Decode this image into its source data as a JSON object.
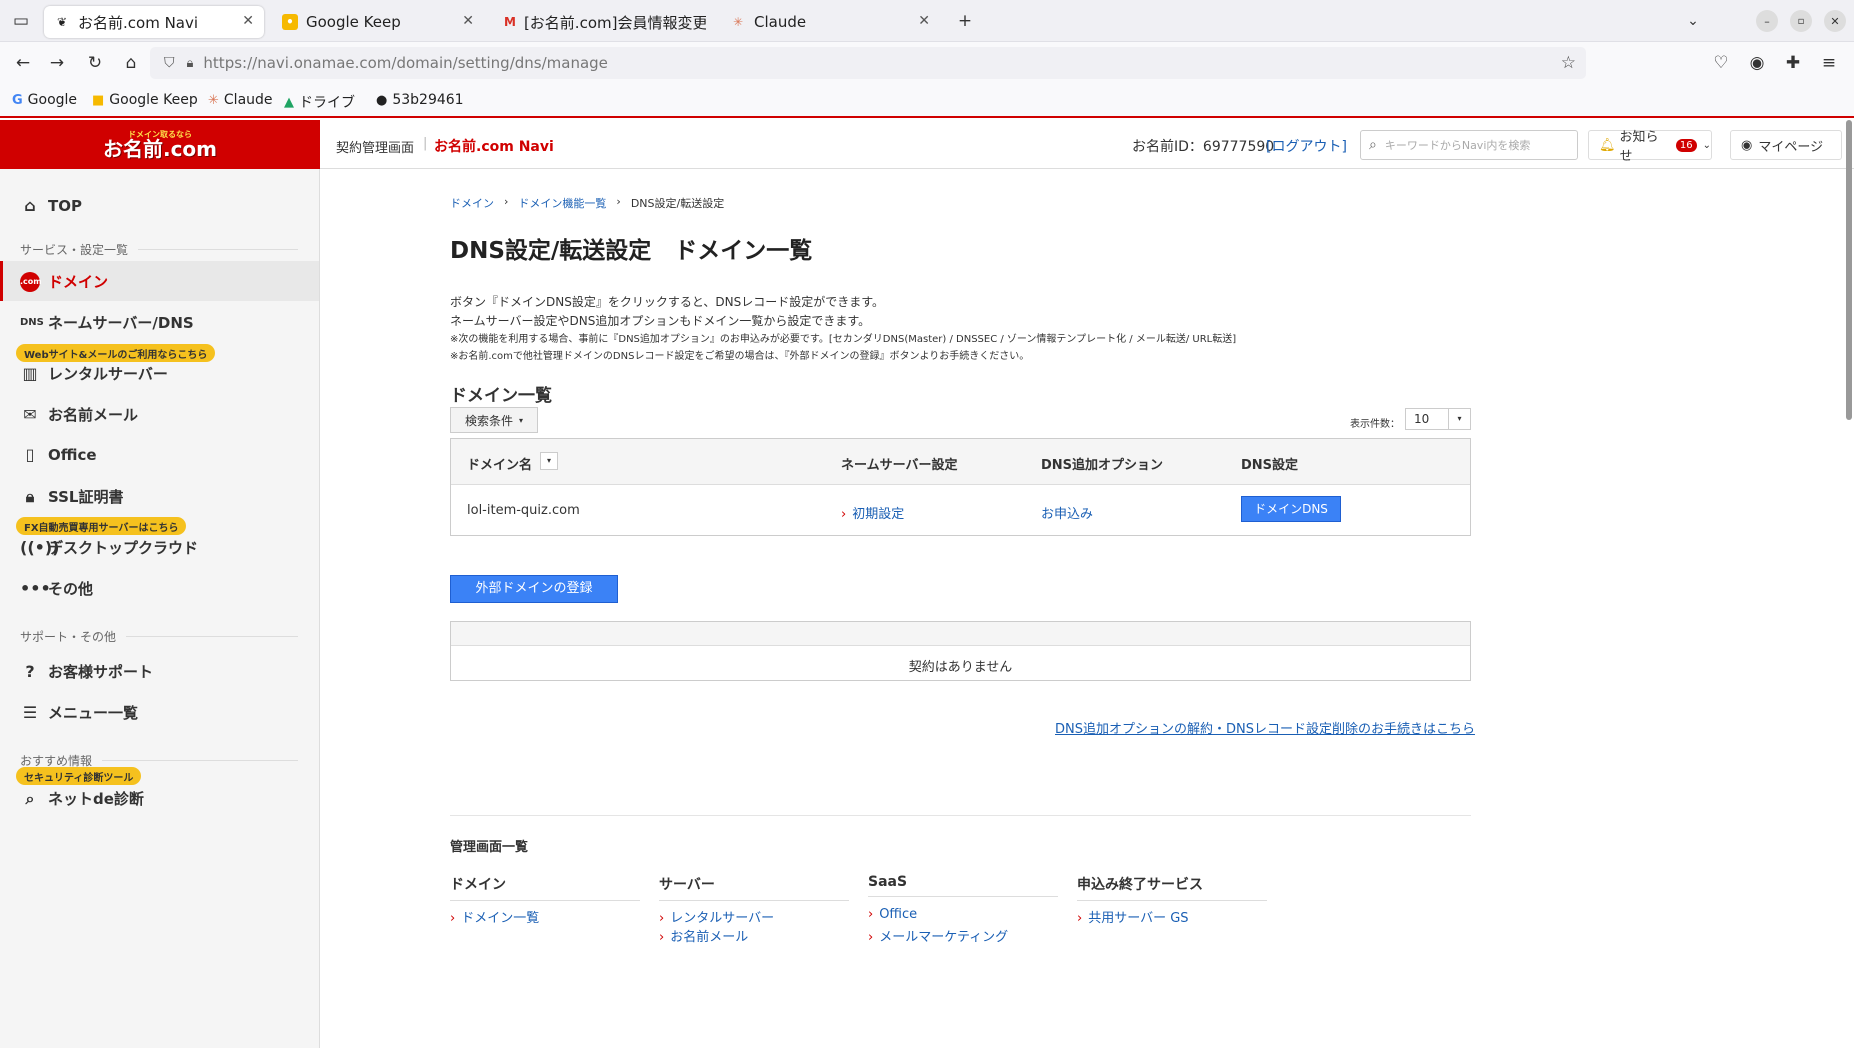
{
  "browser": {
    "tabs": [
      {
        "title": "お名前.com Navi",
        "icon": "onamae-favicon"
      },
      {
        "title": "Google Keep",
        "icon": "keep-favicon"
      },
      {
        "title": "[お名前.com]会員情報変更",
        "icon": "gmail-favicon"
      },
      {
        "title": "Claude",
        "icon": "claude-favicon"
      }
    ],
    "url": "https://navi.onamae.com/domain/setting/dns/manage",
    "bookmarks": [
      "Google",
      "Google Keep",
      "Claude",
      "ドライブ",
      "53b29461"
    ]
  },
  "header": {
    "logo": "お名前.com",
    "logo_tag": "ドメイン取るなら",
    "breadcrumb_left": "契約管理画面",
    "app_name": "お名前.com Navi",
    "member_id": "お名前ID：69777590",
    "logout": "[ログアウト]",
    "search_placeholder": "キーワードからNavi内を検索",
    "notice": "お知らせ",
    "notice_count": "16",
    "mypage": "マイページ"
  },
  "sidebar": {
    "top": "TOP",
    "section_services": "サービス・設定一覧",
    "domain": "ドメイン",
    "nameserver": "ネームサーバー/DNS",
    "rental_pill": "Webサイト&メールのご利用ならこちら",
    "rental": "レンタルサーバー",
    "mail": "お名前メール",
    "office": "Office",
    "ssl": "SSL証明書",
    "fx_pill": "FX自動売買専用サーバーはこちら",
    "desktop": "デスクトップクラウド",
    "other": "その他",
    "section_support": "サポート・その他",
    "support": "お客様サポート",
    "menu": "メニュー一覧",
    "section_reco": "おすすめ情報",
    "security_pill": "セキュリティ診断ツール",
    "net": "ネットde診断"
  },
  "main": {
    "crumb1": "ドメイン",
    "crumb2": "ドメイン機能一覧",
    "crumb3": "DNS設定/転送設定",
    "title": "DNS設定/転送設定　ドメイン一覧",
    "desc1": "ボタン『ドメインDNS設定』をクリックすると、DNSレコード設定ができます。",
    "desc2": "ネームサーバー設定やDNS追加オプションもドメイン一覧から設定できます。",
    "note1": "※次の機能を利用する場合、事前に『DNS追加オプション』のお申込みが必要です。[セカンダリDNS(Master) / DNSSEC / ゾーン情報テンプレート化 / メール転送/ URL転送]",
    "note2": "※お名前.comで他社管理ドメインのDNSレコード設定をご希望の場合は、『外部ドメインの登録』ボタンよりお手続きください。",
    "list_title": "ドメイン一覧",
    "filter": "検索条件",
    "per_page_label": "表示件数：",
    "per_page": "10",
    "columns": [
      "ドメイン名",
      "ネームサーバー設定",
      "DNS追加オプション",
      "DNS設定"
    ],
    "rows": [
      {
        "domain": "lol-item-quiz.com",
        "ns": "初期設定",
        "option": "お申込み",
        "dns": "ドメインDNS"
      }
    ],
    "external_btn": "外部ドメインの登録",
    "empty": "契約はありません",
    "cancel_link": "DNS追加オプションの解約・DNSレコード設定削除のお手続きはこちら"
  },
  "footer": {
    "title": "管理画面一覧",
    "cols": [
      {
        "head": "ドメイン",
        "links": [
          "ドメイン一覧"
        ]
      },
      {
        "head": "サーバー",
        "links": [
          "レンタルサーバー",
          "お名前メール"
        ]
      },
      {
        "head": "SaaS",
        "links": [
          "Office",
          "メールマーケティング"
        ]
      },
      {
        "head": "申込み終了サービス",
        "links": [
          "共用サーバー GS"
        ]
      }
    ]
  },
  "colors": {
    "brand": "#d00000",
    "primary": "#3b82f6",
    "pill": "#f5c11e"
  }
}
